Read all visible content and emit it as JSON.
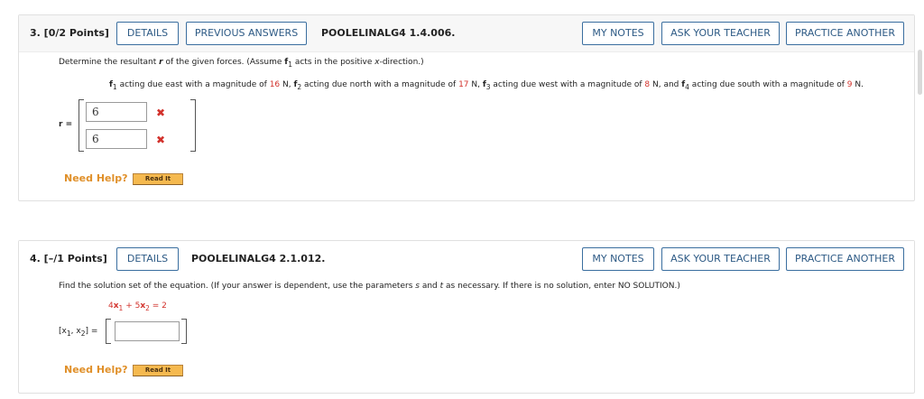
{
  "q3": {
    "number": "3. [0/2 Points]",
    "details": "DETAILS",
    "previous_answers": "PREVIOUS ANSWERS",
    "code": "POOLELINALG4 1.4.006.",
    "my_notes": "MY NOTES",
    "ask_teacher": "ASK YOUR TEACHER",
    "practice": "PRACTICE ANOTHER",
    "prompt_a": "Determine the resultant ",
    "prompt_r": "r",
    "prompt_b": " of the given forces. (Assume ",
    "prompt_f": "f",
    "prompt_sub": "1",
    "prompt_c": " acts in the positive ",
    "prompt_x": "x",
    "prompt_d": "-direction.)",
    "forces": {
      "f1": "f",
      "s1": "1",
      "t1": " acting due east with a magnitude of ",
      "v1": "16",
      "u1": " N, ",
      "f2": "f",
      "s2": "2",
      "t2": " acting due north with a magnitude of ",
      "v2": "17",
      "u2": " N, ",
      "f3": "f",
      "s3": "3",
      "t3": " acting due west with a magnitude of ",
      "v3": "8",
      "u3": " N, and ",
      "f4": "f",
      "s4": "4",
      "t4": " acting due south with a magnitude of ",
      "v4": "9",
      "u4": " N."
    },
    "r_label": "r =",
    "answer1": "6",
    "answer2": "6",
    "wrong_mark": "✖",
    "need_help": "Need Help?",
    "read_it": "Read It"
  },
  "q4": {
    "number": "4. [–/1 Points]",
    "details": "DETAILS",
    "code": "POOLELINALG4 2.1.012.",
    "my_notes": "MY NOTES",
    "ask_teacher": "ASK YOUR TEACHER",
    "practice": "PRACTICE ANOTHER",
    "prompt_a": "Find the solution set of the equation. (If your answer is dependent, use the parameters ",
    "prompt_s": "s",
    "prompt_and": " and ",
    "prompt_t": "t",
    "prompt_b": " as necessary. If there is no solution, enter NO SOLUTION.)",
    "eq": {
      "c1": "4",
      "x1": "x",
      "i1": "1",
      "plus": " + ",
      "c2": "5",
      "x2": "x",
      "i2": "2",
      "rhs": " = 2"
    },
    "label": {
      "open": "[",
      "x1": "x",
      "i1": "1",
      "comma": ", ",
      "x2": "x",
      "i2": "2",
      "close": "] ="
    },
    "answer_value": "",
    "need_help": "Need Help?",
    "read_it": "Read It"
  },
  "colors": {
    "accent": "#2d5a85",
    "wrong": "#d2312b",
    "help": "#e0902a",
    "readit": "#f5b94f"
  }
}
